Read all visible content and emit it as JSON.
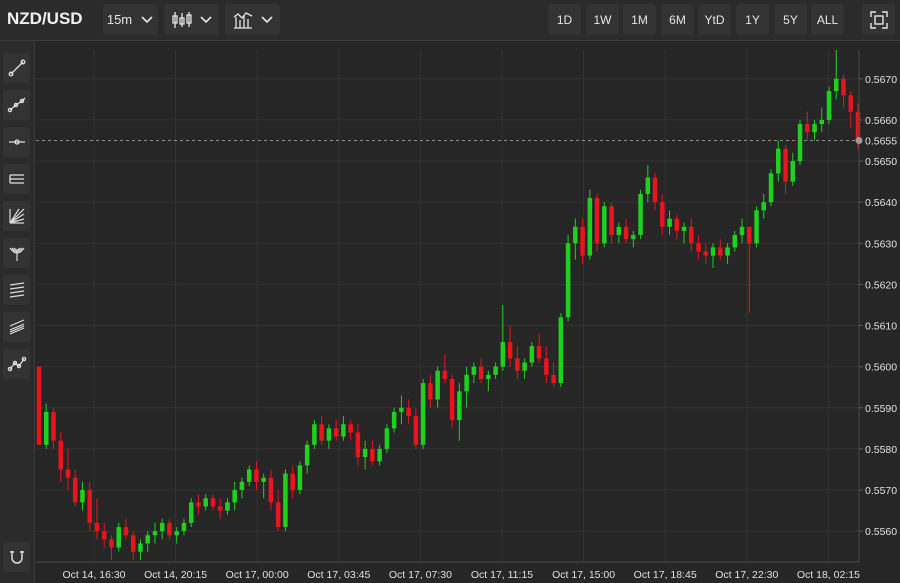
{
  "toolbar": {
    "symbol": "NZD/USD",
    "interval": "15m",
    "chart_type_icon": "candlestick-icon",
    "indicators_icon": "indicators-icon",
    "ranges": [
      "1D",
      "1W",
      "1M",
      "6M",
      "YtD",
      "1Y",
      "5Y",
      "ALL"
    ],
    "fullscreen_icon": "fullscreen-icon"
  },
  "sidebar": {
    "tools": [
      "trend-line-icon",
      "multi-point-line-icon",
      "horizontal-ray-icon",
      "parallel-channel-icon",
      "fan-icon",
      "pitchfork-icon",
      "fibonacci-icon",
      "regression-icon",
      "path-icon"
    ],
    "bottom_tool": "magnet-icon"
  },
  "chart_data": {
    "type": "candlestick",
    "colors": {
      "up": "#1fd11f",
      "down": "#e8141e",
      "background": "#262626",
      "grid": "#333333",
      "current_price_line": "#8c8c8c"
    },
    "x_ticks": [
      "Oct 14, 16:30",
      "Oct 14, 20:15",
      "Oct 17, 00:00",
      "Oct 17, 03:45",
      "Oct 17, 07:30",
      "Oct 17, 11:15",
      "Oct 17, 15:00",
      "Oct 17, 18:45",
      "Oct 17, 22:30",
      "Oct 18, 02:15"
    ],
    "y_ticks": [
      "0.5670",
      "0.5660",
      "0.5650",
      "0.5640",
      "0.5630",
      "0.5620",
      "0.5610",
      "0.5600",
      "0.5590",
      "0.5580",
      "0.5570",
      "0.5560"
    ],
    "ylim": [
      0.55525,
      0.5677
    ],
    "current_price": "0.5655",
    "grid": true,
    "candles": [
      [
        0.56,
        0.56,
        0.5581,
        0.5581
      ],
      [
        0.5581,
        0.5591,
        0.558,
        0.5589
      ],
      [
        0.5589,
        0.559,
        0.558,
        0.5582
      ],
      [
        0.5582,
        0.5584,
        0.5572,
        0.5575
      ],
      [
        0.5575,
        0.558,
        0.557,
        0.5573
      ],
      [
        0.5573,
        0.5575,
        0.5566,
        0.5567
      ],
      [
        0.5567,
        0.5572,
        0.5565,
        0.557
      ],
      [
        0.557,
        0.5572,
        0.556,
        0.5562
      ],
      [
        0.5562,
        0.5568,
        0.5558,
        0.556
      ],
      [
        0.556,
        0.5562,
        0.5556,
        0.5558
      ],
      [
        0.5558,
        0.5559,
        0.5553,
        0.5556
      ],
      [
        0.5556,
        0.5562,
        0.5555,
        0.5561
      ],
      [
        0.5561,
        0.5563,
        0.5558,
        0.5559
      ],
      [
        0.5559,
        0.556,
        0.5553,
        0.5555
      ],
      [
        0.5555,
        0.5558,
        0.5553,
        0.5557
      ],
      [
        0.5557,
        0.556,
        0.5555,
        0.5559
      ],
      [
        0.5559,
        0.5562,
        0.5557,
        0.556
      ],
      [
        0.556,
        0.5563,
        0.5558,
        0.5562
      ],
      [
        0.5562,
        0.5563,
        0.5558,
        0.5559
      ],
      [
        0.5559,
        0.5561,
        0.5557,
        0.556
      ],
      [
        0.556,
        0.5563,
        0.5559,
        0.5562
      ],
      [
        0.5562,
        0.5568,
        0.5561,
        0.5567
      ],
      [
        0.5567,
        0.5569,
        0.5564,
        0.5566
      ],
      [
        0.5566,
        0.5569,
        0.5565,
        0.5568
      ],
      [
        0.5568,
        0.5569,
        0.5565,
        0.5566
      ],
      [
        0.5566,
        0.5568,
        0.5563,
        0.5565
      ],
      [
        0.5565,
        0.5568,
        0.5564,
        0.5567
      ],
      [
        0.5567,
        0.5572,
        0.5565,
        0.557
      ],
      [
        0.557,
        0.5573,
        0.5568,
        0.5572
      ],
      [
        0.5572,
        0.5576,
        0.5571,
        0.5575
      ],
      [
        0.5575,
        0.5577,
        0.557,
        0.5572
      ],
      [
        0.5572,
        0.5574,
        0.5568,
        0.5573
      ],
      [
        0.5573,
        0.5575,
        0.5565,
        0.5567
      ],
      [
        0.5567,
        0.557,
        0.556,
        0.5561
      ],
      [
        0.5561,
        0.5575,
        0.556,
        0.5574
      ],
      [
        0.5574,
        0.5576,
        0.5568,
        0.557
      ],
      [
        0.557,
        0.5577,
        0.5569,
        0.5576
      ],
      [
        0.5576,
        0.5582,
        0.5574,
        0.5581
      ],
      [
        0.5581,
        0.5587,
        0.558,
        0.5586
      ],
      [
        0.5586,
        0.5588,
        0.5581,
        0.5582
      ],
      [
        0.5582,
        0.5586,
        0.558,
        0.5585
      ],
      [
        0.5585,
        0.5587,
        0.5582,
        0.5583
      ],
      [
        0.5583,
        0.5588,
        0.5582,
        0.5586
      ],
      [
        0.5586,
        0.5587,
        0.5582,
        0.5584
      ],
      [
        0.5584,
        0.5586,
        0.5576,
        0.5578
      ],
      [
        0.5578,
        0.5582,
        0.5575,
        0.558
      ],
      [
        0.558,
        0.5582,
        0.5576,
        0.5577
      ],
      [
        0.5577,
        0.5581,
        0.5576,
        0.558
      ],
      [
        0.558,
        0.5586,
        0.5579,
        0.5585
      ],
      [
        0.5585,
        0.559,
        0.5584,
        0.5589
      ],
      [
        0.5589,
        0.5593,
        0.5586,
        0.559
      ],
      [
        0.559,
        0.5592,
        0.5586,
        0.5588
      ],
      [
        0.5588,
        0.559,
        0.558,
        0.5581
      ],
      [
        0.5581,
        0.5597,
        0.558,
        0.5596
      ],
      [
        0.5596,
        0.5598,
        0.559,
        0.5592
      ],
      [
        0.5592,
        0.56,
        0.559,
        0.5599
      ],
      [
        0.5599,
        0.5603,
        0.5596,
        0.5597
      ],
      [
        0.5597,
        0.5598,
        0.5585,
        0.5587
      ],
      [
        0.5587,
        0.5596,
        0.5582,
        0.5594
      ],
      [
        0.5594,
        0.56,
        0.559,
        0.5598
      ],
      [
        0.5598,
        0.5601,
        0.5596,
        0.56
      ],
      [
        0.56,
        0.5602,
        0.5596,
        0.5597
      ],
      [
        0.5597,
        0.5599,
        0.5594,
        0.5598
      ],
      [
        0.5598,
        0.5601,
        0.5597,
        0.56
      ],
      [
        0.56,
        0.5615,
        0.5599,
        0.5606
      ],
      [
        0.5606,
        0.561,
        0.56,
        0.5602
      ],
      [
        0.5602,
        0.5605,
        0.5597,
        0.5599
      ],
      [
        0.5599,
        0.5602,
        0.5597,
        0.5601
      ],
      [
        0.5601,
        0.5606,
        0.56,
        0.5605
      ],
      [
        0.5605,
        0.5608,
        0.5601,
        0.5602
      ],
      [
        0.5602,
        0.5605,
        0.5596,
        0.5598
      ],
      [
        0.5598,
        0.5601,
        0.5595,
        0.5596
      ],
      [
        0.5596,
        0.5613,
        0.5595,
        0.5612
      ],
      [
        0.5612,
        0.5632,
        0.5611,
        0.563
      ],
      [
        0.563,
        0.5636,
        0.5626,
        0.5634
      ],
      [
        0.5634,
        0.5636,
        0.5625,
        0.5627
      ],
      [
        0.5627,
        0.5643,
        0.5626,
        0.5641
      ],
      [
        0.5641,
        0.5642,
        0.5628,
        0.563
      ],
      [
        0.563,
        0.564,
        0.5629,
        0.5639
      ],
      [
        0.5639,
        0.564,
        0.563,
        0.5632
      ],
      [
        0.5632,
        0.5635,
        0.563,
        0.5634
      ],
      [
        0.5634,
        0.5636,
        0.563,
        0.5631
      ],
      [
        0.5631,
        0.5633,
        0.5629,
        0.5632
      ],
      [
        0.5632,
        0.5643,
        0.5631,
        0.5642
      ],
      [
        0.5642,
        0.5649,
        0.564,
        0.5646
      ],
      [
        0.5646,
        0.5647,
        0.5638,
        0.564
      ],
      [
        0.564,
        0.5642,
        0.5632,
        0.5634
      ],
      [
        0.5634,
        0.5638,
        0.5632,
        0.5636
      ],
      [
        0.5636,
        0.5637,
        0.5631,
        0.5633
      ],
      [
        0.5633,
        0.5635,
        0.563,
        0.5634
      ],
      [
        0.5634,
        0.5636,
        0.5628,
        0.563
      ],
      [
        0.563,
        0.5632,
        0.5626,
        0.5628
      ],
      [
        0.5628,
        0.563,
        0.5625,
        0.5627
      ],
      [
        0.5627,
        0.563,
        0.5624,
        0.5629
      ],
      [
        0.5629,
        0.5631,
        0.5626,
        0.5627
      ],
      [
        0.5627,
        0.563,
        0.5625,
        0.5629
      ],
      [
        0.5629,
        0.5633,
        0.5628,
        0.5632
      ],
      [
        0.5632,
        0.5636,
        0.563,
        0.5634
      ],
      [
        0.5634,
        0.5634,
        0.5613,
        0.563
      ],
      [
        0.563,
        0.5639,
        0.5629,
        0.5638
      ],
      [
        0.5638,
        0.5642,
        0.5636,
        0.564
      ],
      [
        0.564,
        0.5648,
        0.5639,
        0.5647
      ],
      [
        0.5647,
        0.5655,
        0.5645,
        0.5653
      ],
      [
        0.5653,
        0.5654,
        0.5642,
        0.5645
      ],
      [
        0.5645,
        0.5652,
        0.5644,
        0.565
      ],
      [
        0.565,
        0.566,
        0.5649,
        0.5659
      ],
      [
        0.5659,
        0.5662,
        0.5655,
        0.5657
      ],
      [
        0.5657,
        0.566,
        0.5655,
        0.5659
      ],
      [
        0.5659,
        0.5663,
        0.5657,
        0.566
      ],
      [
        0.566,
        0.5668,
        0.5659,
        0.5667
      ],
      [
        0.5667,
        0.5677,
        0.5665,
        0.567
      ],
      [
        0.567,
        0.5671,
        0.5663,
        0.5666
      ],
      [
        0.5666,
        0.5667,
        0.5658,
        0.5662
      ],
      [
        0.5662,
        0.5664,
        0.5653,
        0.5655
      ]
    ]
  }
}
